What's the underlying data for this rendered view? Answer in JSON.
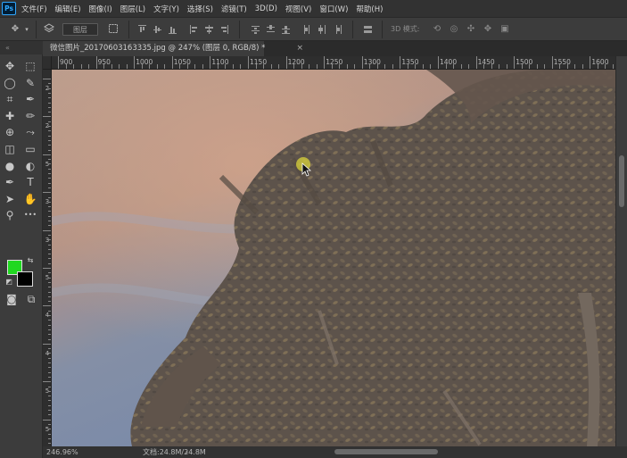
{
  "app": {
    "logo": "Ps"
  },
  "menu": [
    "文件(F)",
    "编辑(E)",
    "图像(I)",
    "图层(L)",
    "文字(Y)",
    "选择(S)",
    "滤镜(T)",
    "3D(D)",
    "视图(V)",
    "窗口(W)",
    "帮助(H)"
  ],
  "options": {
    "move_arrow": "✥",
    "auto_select_value": "图层",
    "mode_3d_label": "3D 模式:"
  },
  "document": {
    "tab_title": "微信图片_20170603163335.jpg @ 247% (图层 0, RGB/8) *",
    "close": "×"
  },
  "ruler_top": [
    "900",
    "950",
    "1000",
    "1050",
    "1100",
    "1150",
    "1200",
    "1250",
    "1300",
    "1350",
    "1400",
    "1450",
    "1500",
    "1550",
    "1600"
  ],
  "ruler_left": [
    "2",
    "2",
    "5",
    "3",
    "3",
    "5",
    "4",
    "4",
    "5",
    "5"
  ],
  "tools_header": "«",
  "tools": [
    {
      "name": "move-tool",
      "glyph": "✥"
    },
    {
      "name": "marquee-tool",
      "glyph": "⬚"
    },
    {
      "name": "lasso-tool",
      "glyph": "◯"
    },
    {
      "name": "quick-select-tool",
      "glyph": "✎"
    },
    {
      "name": "crop-tool",
      "glyph": "⌗"
    },
    {
      "name": "eyedropper-tool",
      "glyph": "✒"
    },
    {
      "name": "healing-brush-tool",
      "glyph": "✚"
    },
    {
      "name": "brush-tool",
      "glyph": "✏"
    },
    {
      "name": "stamp-tool",
      "glyph": "⊕"
    },
    {
      "name": "history-brush-tool",
      "glyph": "⤳"
    },
    {
      "name": "eraser-tool",
      "glyph": "◫"
    },
    {
      "name": "gradient-tool",
      "glyph": "▭"
    },
    {
      "name": "blur-tool",
      "glyph": "●"
    },
    {
      "name": "dodge-tool",
      "glyph": "◐"
    },
    {
      "name": "pen-tool",
      "glyph": "✒"
    },
    {
      "name": "type-tool",
      "glyph": "T"
    },
    {
      "name": "path-select-tool",
      "glyph": "➤"
    },
    {
      "name": "hand-tool",
      "glyph": "✋"
    },
    {
      "name": "zoom-tool",
      "glyph": "⚲"
    },
    {
      "name": "more-tools",
      "glyph": "•••"
    }
  ],
  "colors": {
    "foreground": "#20d820",
    "background": "#000000"
  },
  "status": {
    "zoom": "246.96%",
    "doc": "文档:24.8M/24.8M",
    "arrow": "›"
  }
}
